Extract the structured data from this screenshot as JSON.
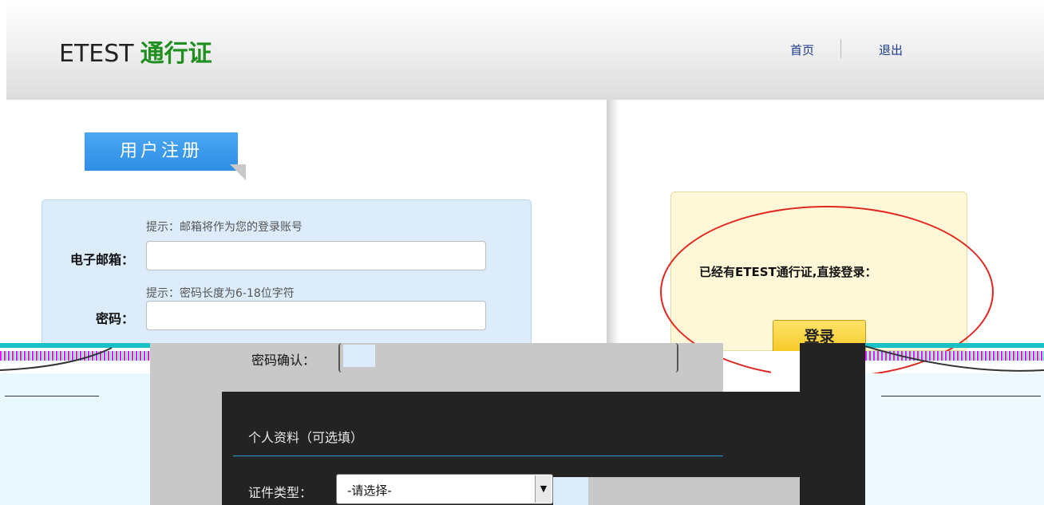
{
  "header": {
    "brand_primary": "ETEST",
    "brand_secondary": "通行证",
    "nav": [
      {
        "label": "首页"
      },
      {
        "label": "退出"
      }
    ]
  },
  "registration": {
    "tab_title": "用户注册",
    "email": {
      "hint": "提示：邮箱将作为您的登录账号",
      "label": "电子邮箱：",
      "value": ""
    },
    "password": {
      "hint": "提示：密码长度为6-18位字符",
      "label": "密码：",
      "value": ""
    },
    "password_confirm": {
      "label": "密码确认：",
      "value": ""
    },
    "personal_section_title": "个人资料（可选填）",
    "id_type": {
      "label": "证件类型：",
      "selected": "-请选择-"
    }
  },
  "login": {
    "prompt": "已经有ETEST通行证,直接登录：",
    "button_label": "登录"
  },
  "colors": {
    "brand_green": "#1f8f1f",
    "tab_blue": "#2f8fe6",
    "form_bg": "#dcecfb",
    "login_bg": "#fff8d8",
    "highlight_red": "#e2261f",
    "login_button": "#f3c419"
  }
}
